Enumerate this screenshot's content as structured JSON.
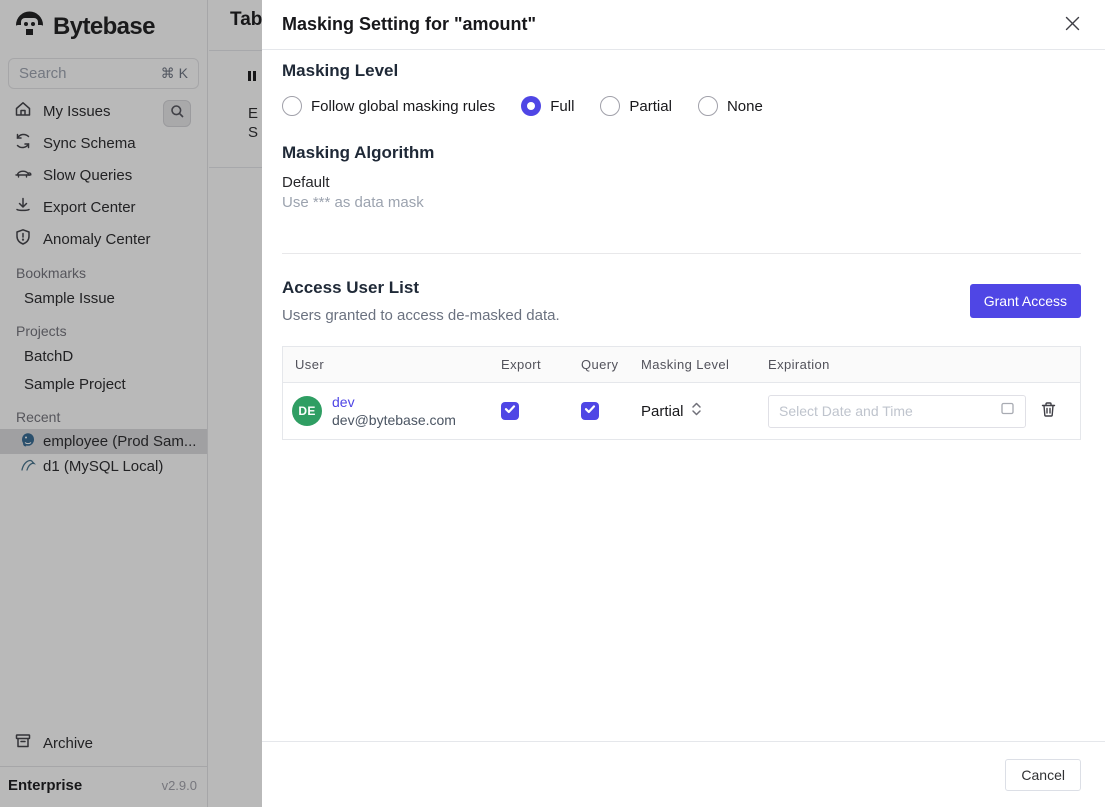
{
  "colors": {
    "accent": "#4f46e5",
    "avatar_green": "#2f9e63",
    "overlay": "rgba(23,23,23,0.3)"
  },
  "sidebar": {
    "brand": "Bytebase",
    "search_placeholder": "Search",
    "search_shortcut": "⌘ K",
    "nav": [
      {
        "label": "My Issues",
        "icon": "home-icon"
      },
      {
        "label": "Sync Schema",
        "icon": "sync-icon"
      },
      {
        "label": "Slow Queries",
        "icon": "turtle-icon"
      },
      {
        "label": "Export Center",
        "icon": "download-icon"
      },
      {
        "label": "Anomaly Center",
        "icon": "shield-icon"
      }
    ],
    "sections": [
      {
        "title": "Bookmarks",
        "items": [
          "Sample Issue"
        ]
      },
      {
        "title": "Projects",
        "items": [
          "BatchD",
          "Sample Project"
        ]
      },
      {
        "title": "Recent",
        "items": [
          "employee (Prod Sam...",
          "d1 (MySQL Local)"
        ]
      }
    ],
    "archive_label": "Archive",
    "plan": "Enterprise",
    "version": "v2.9.0"
  },
  "page_behind": {
    "title_fragment": "Tab",
    "fragment_e": "E",
    "fragment_s": "S"
  },
  "modal": {
    "title": "Masking Setting for \"amount\"",
    "masking_level": {
      "heading": "Masking Level",
      "options": [
        {
          "label": "Follow global masking rules",
          "selected": false
        },
        {
          "label": "Full",
          "selected": true
        },
        {
          "label": "Partial",
          "selected": false
        },
        {
          "label": "None",
          "selected": false
        }
      ]
    },
    "masking_algorithm": {
      "heading": "Masking Algorithm",
      "name": "Default",
      "description": "Use *** as data mask"
    },
    "access": {
      "heading": "Access User List",
      "subheading": "Users granted to access de-masked data.",
      "grant_button": "Grant Access",
      "table": {
        "columns": [
          "User",
          "Export",
          "Query",
          "Masking Level",
          "Expiration"
        ],
        "rows": [
          {
            "avatar_initials": "DE",
            "name": "dev",
            "email": "dev@bytebase.com",
            "export_checked": true,
            "query_checked": true,
            "masking_level": "Partial",
            "expiration_placeholder": "Select Date and Time"
          }
        ]
      }
    },
    "cancel_button": "Cancel"
  }
}
